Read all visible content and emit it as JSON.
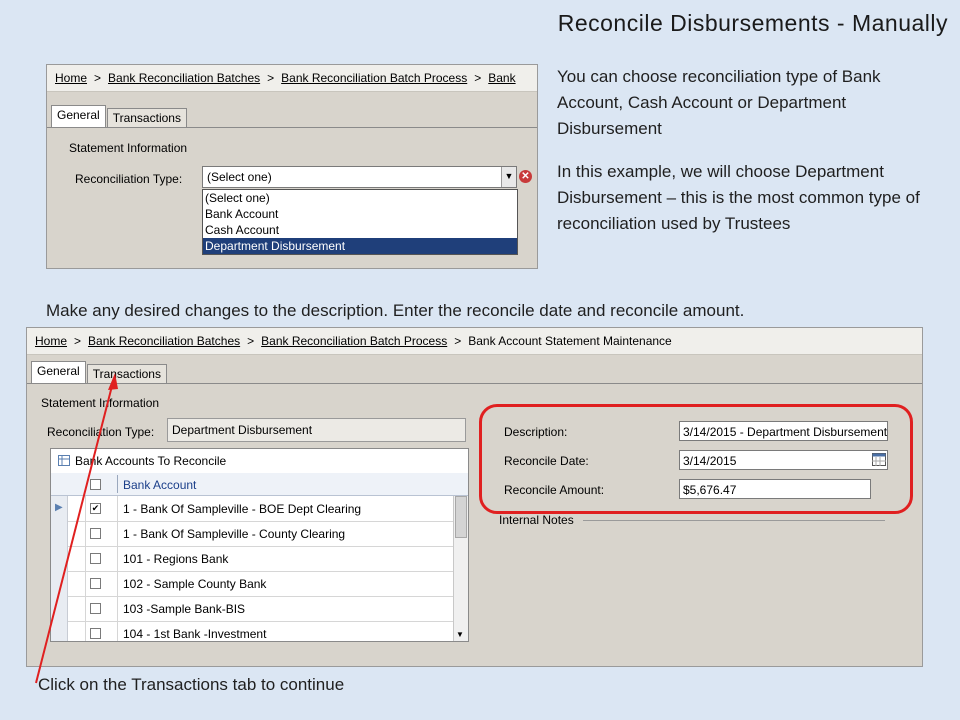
{
  "slide": {
    "title": "Reconcile Disbursements - Manually",
    "note1": "You can choose reconciliation type of Bank Account, Cash Account or Department Disbursement",
    "note2": "In this example, we will choose Department Disbursement – this is the most common type of reconciliation used by Trustees",
    "note3": "Make any desired changes to the description.  Enter the reconcile date and reconcile amount.",
    "note4": "Click on the Transactions tab to continue"
  },
  "shot1": {
    "breadcrumb": [
      "Home",
      "Bank Reconciliation Batches",
      "Bank Reconciliation Batch Process",
      "Bank"
    ],
    "sep": ">",
    "tabs": [
      "General",
      "Transactions"
    ],
    "section": "Statement Information",
    "recon_label": "Reconciliation Type:",
    "recon_value": "(Select one)",
    "options": [
      "(Select one)",
      "Bank Account",
      "Cash Account",
      "Department Disbursement"
    ]
  },
  "shot2": {
    "breadcrumb": [
      "Home",
      "Bank Reconciliation Batches",
      "Bank Reconciliation Batch Process",
      "Bank Account Statement Maintenance"
    ],
    "sep": ">",
    "tabs": [
      "General",
      "Transactions"
    ],
    "section": "Statement Information",
    "recon_label": "Reconciliation Type:",
    "recon_value": "Department Disbursement",
    "grid_title": "Bank Accounts To Reconcile",
    "grid_col": "Bank Account",
    "rows": [
      {
        "name": "1 - Bank Of Sampleville - BOE Dept Clearing",
        "checked": "✔"
      },
      {
        "name": "1 - Bank Of Sampleville - County Clearing",
        "checked": ""
      },
      {
        "name": "101 - Regions Bank",
        "checked": ""
      },
      {
        "name": "102 - Sample County Bank",
        "checked": ""
      },
      {
        "name": "103 -Sample Bank-BIS",
        "checked": ""
      },
      {
        "name": "104 - 1st Bank -Investment",
        "checked": ""
      }
    ],
    "desc_label": "Description:",
    "desc_value": "3/14/2015 - Department Disbursement",
    "date_label": "Reconcile Date:",
    "date_value": "3/14/2015",
    "amount_label": "Reconcile Amount:",
    "amount_value": "$5,676.47",
    "internal_notes": "Internal Notes"
  },
  "colors": {
    "highlight": "#e02020",
    "selection": "#1f3f7a",
    "arrow": "#e02020"
  }
}
